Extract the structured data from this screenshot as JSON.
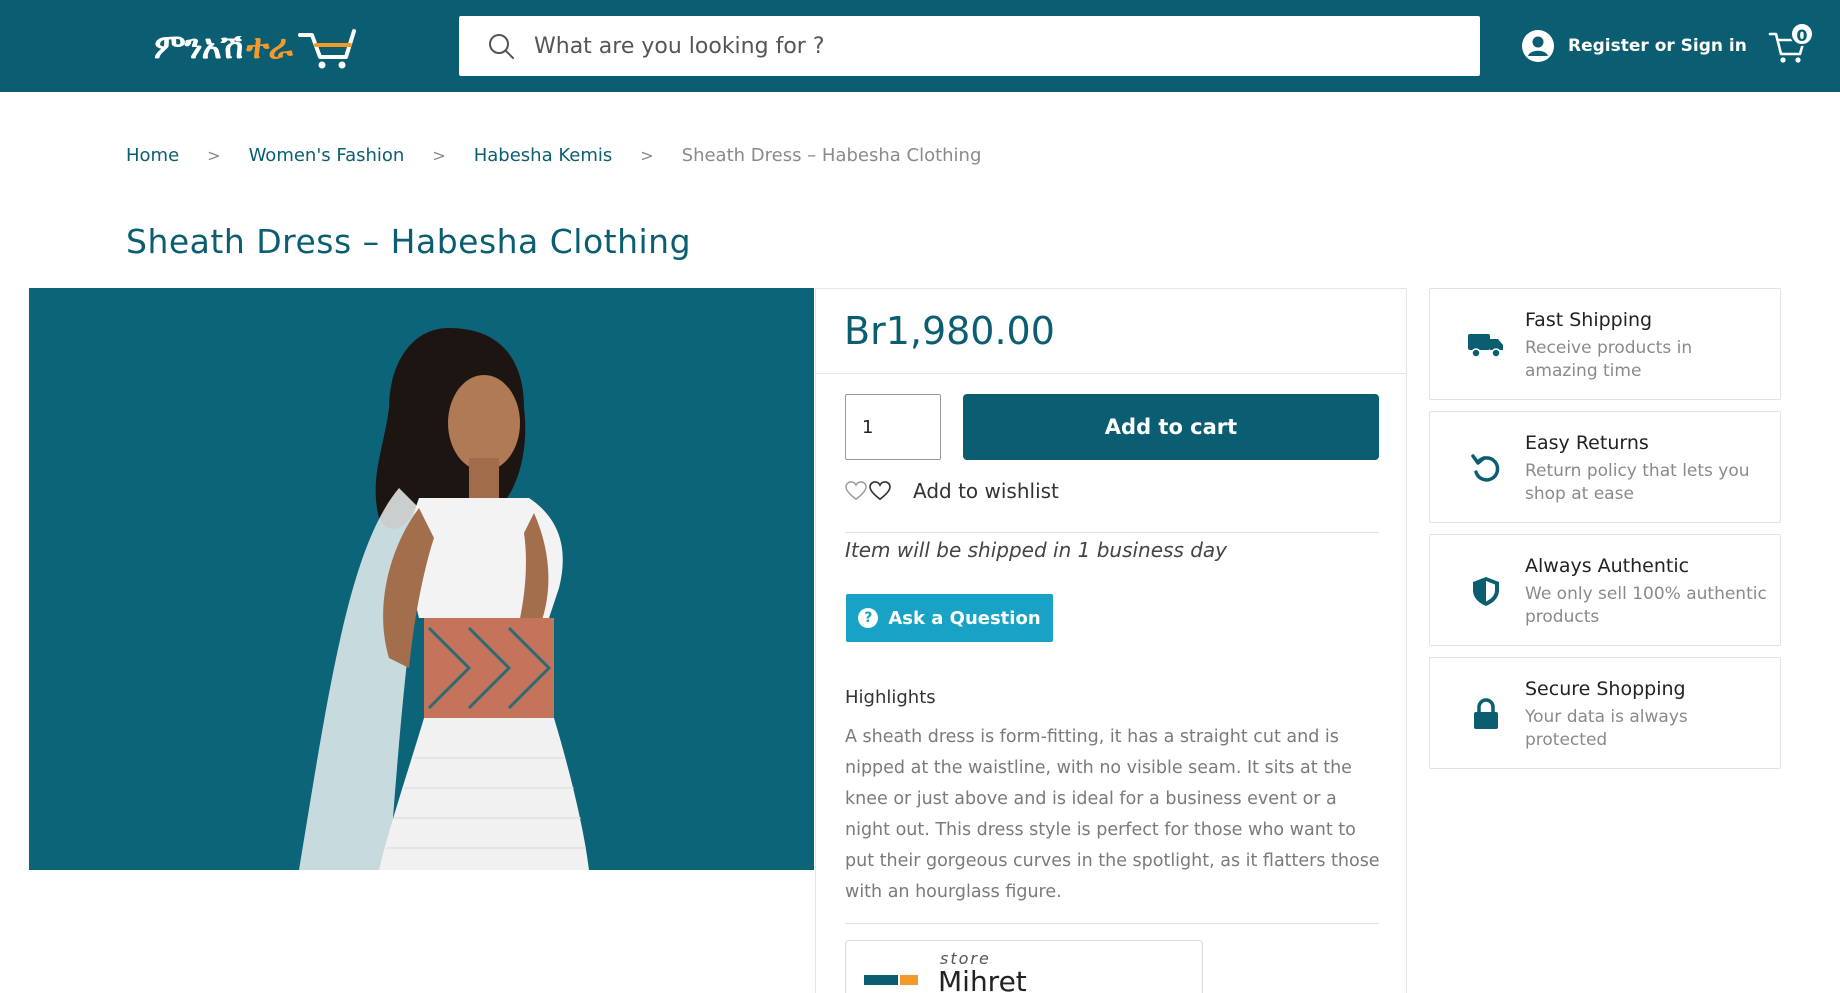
{
  "header": {
    "logo_text_white": "ምንአሽ",
    "logo_text_orange": "ተራ",
    "search_placeholder": "What are you looking for ?",
    "account_label": "Register or Sign in",
    "cart_count": "0"
  },
  "breadcrumb": {
    "items": [
      "Home",
      "Women's Fashion",
      "Habesha Kemis"
    ],
    "separator": ">",
    "current": "Sheath Dress – Habesha Clothing"
  },
  "product": {
    "title": "Sheath Dress – Habesha Clothing",
    "price": "Br1,980.00",
    "quantity": "1",
    "add_to_cart_label": "Add to cart",
    "wishlist_label": "Add to wishlist",
    "shipping_note": "Item will be shipped in 1 business day",
    "ask_label": "Ask a Question",
    "highlights_title": "Highlights",
    "highlights_text": "A sheath dress is form-fitting, it has a straight cut and is nipped at the waistline, with no visible seam. It sits at the knee or just above and is ideal for a business event or a night out. This dress style is perfect for those who want to put their gorgeous curves in the spotlight, as it flatters those with an hourglass figure.",
    "store_label": "store",
    "store_name": "Mihret"
  },
  "features": [
    {
      "icon": "truck-icon",
      "title": "Fast Shipping",
      "desc": "Receive products in amazing time"
    },
    {
      "icon": "undo-icon",
      "title": "Easy Returns",
      "desc": "Return policy that lets you shop at ease"
    },
    {
      "icon": "shield-icon",
      "title": "Always Authentic",
      "desc": "We only sell 100% authentic products"
    },
    {
      "icon": "lock-icon",
      "title": "Secure Shopping",
      "desc": "Your data is always protected"
    }
  ],
  "colors": {
    "brand": "#0b5e72",
    "accent": "#f39a2b",
    "ask_button": "#17a2c6"
  }
}
